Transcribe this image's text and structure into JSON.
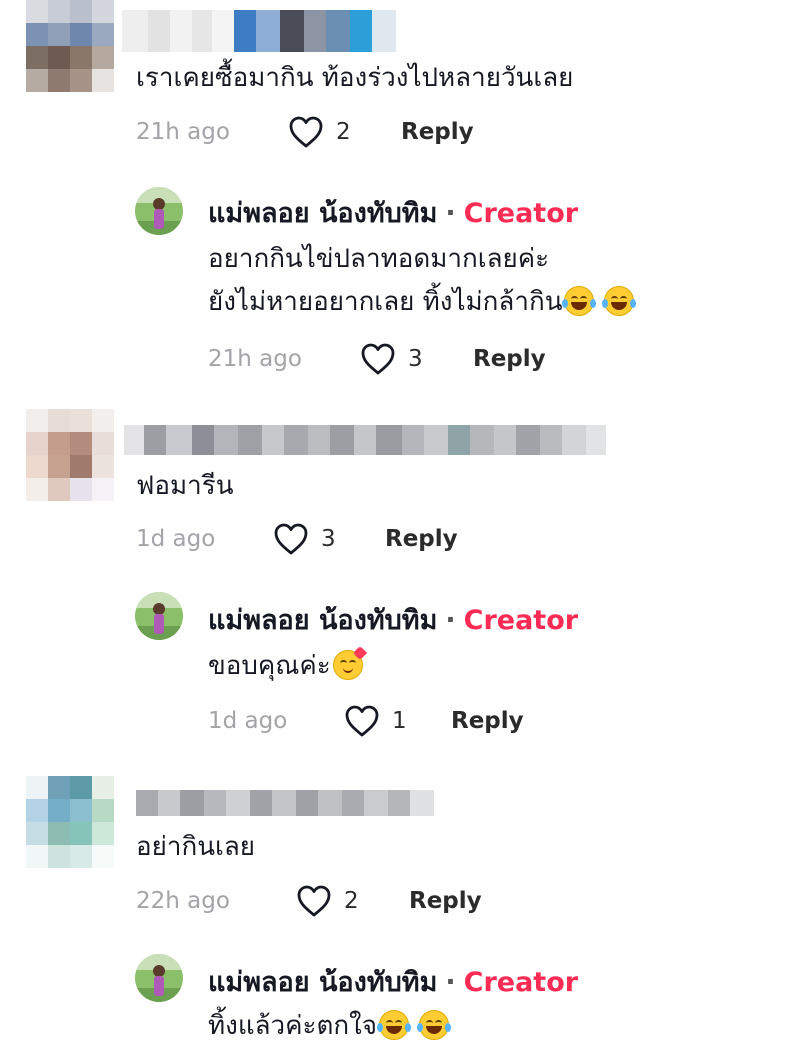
{
  "colors": {
    "accent": "#fe2c55",
    "meta": "#a3a3a8"
  },
  "comments": [
    {
      "text": "เราเคยซื้อมากิน ท้องร่วงไปหลายวันเลย",
      "time": "21h ago",
      "likes": "2",
      "reply_label": "Reply",
      "reply": {
        "author": "แม่พลอย น้องทับทิม",
        "badge": "Creator",
        "line1": "อยากกินไข่ปลาทอดมากเลยค่ะ",
        "line2": "ยังไม่หายอยากเลย ทิ้งไม่กล้ากิน",
        "time": "21h ago",
        "likes": "3",
        "reply_label": "Reply"
      }
    },
    {
      "text": "ฟอมารีน",
      "time": "1d ago",
      "likes": "3",
      "reply_label": "Reply",
      "reply": {
        "author": "แม่พลอย น้องทับทิม",
        "badge": "Creator",
        "line1": "ขอบคุณค่ะ",
        "time": "1d ago",
        "likes": "1",
        "reply_label": "Reply"
      }
    },
    {
      "text": "อย่ากินเลย",
      "time": "22h ago",
      "likes": "2",
      "reply_label": "Reply",
      "reply": {
        "author": "แม่พลอย น้องทับทิม",
        "badge": "Creator",
        "line1": "ทิ้งแล้วค่ะตกใจ"
      }
    }
  ]
}
